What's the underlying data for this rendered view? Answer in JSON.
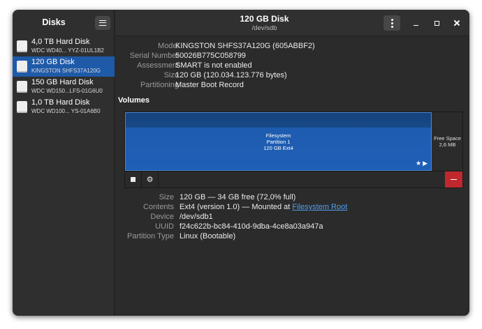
{
  "sidebar": {
    "title": "Disks",
    "disks": [
      {
        "name": "4,0 TB Hard Disk",
        "model": "WDC WD40... YYZ-01UL1B2",
        "selected": false
      },
      {
        "name": "120 GB Disk",
        "model": "KINGSTON SHFS37A120G",
        "selected": true
      },
      {
        "name": "150 GB Hard Disk",
        "model": "WDC WD150...LFS-01G6U0",
        "selected": false
      },
      {
        "name": "1,0 TB Hard Disk",
        "model": "WDC WD100...  YS-01A6B0",
        "selected": false
      }
    ]
  },
  "header": {
    "title": "120 GB Disk",
    "subtitle": "/dev/sdb"
  },
  "disk_info": {
    "model_label": "Model",
    "model_value": "KINGSTON SHFS37A120G (605ABBF2)",
    "serial_label": "Serial Number",
    "serial_value": "50026B775C058799",
    "assessment_label": "Assessment",
    "assessment_value": "SMART is not enabled",
    "size_label": "Size",
    "size_value": "120 GB (120.034.123.776 bytes)",
    "partitioning_label": "Partitioning",
    "partitioning_value": "Master Boot Record"
  },
  "volumes": {
    "title": "Volumes",
    "partition_line1": "Filesystem",
    "partition_line2": "Partition 1",
    "partition_line3": "120 GB Ext4",
    "free_line1": "Free Space",
    "free_line2": "2,6 MB"
  },
  "partition_info": {
    "size_label": "Size",
    "size_value": "120 GB — 34 GB free (72,0% full)",
    "contents_label": "Contents",
    "contents_value": "Ext4 (version 1.0) — Mounted at ",
    "contents_link": "Filesystem Root",
    "device_label": "Device",
    "device_value": "/dev/sdb1",
    "uuid_label": "UUID",
    "uuid_value": "f24c622b-bc84-410d-9dba-4ce8a03a947a",
    "type_label": "Partition Type",
    "type_value": "Linux (Bootable)"
  },
  "colors": {
    "selection": "#1f5aa8",
    "partition": "#1f5fb6",
    "delete": "#c0282d",
    "link": "#4f9ef2"
  },
  "icons": [
    "hamburger-menu-icon",
    "kebab-menu-icon",
    "minimize-icon",
    "maximize-icon",
    "close-icon",
    "disk-icon",
    "star-icon",
    "play-icon",
    "stop-icon",
    "gears-icon",
    "minus-icon"
  ]
}
